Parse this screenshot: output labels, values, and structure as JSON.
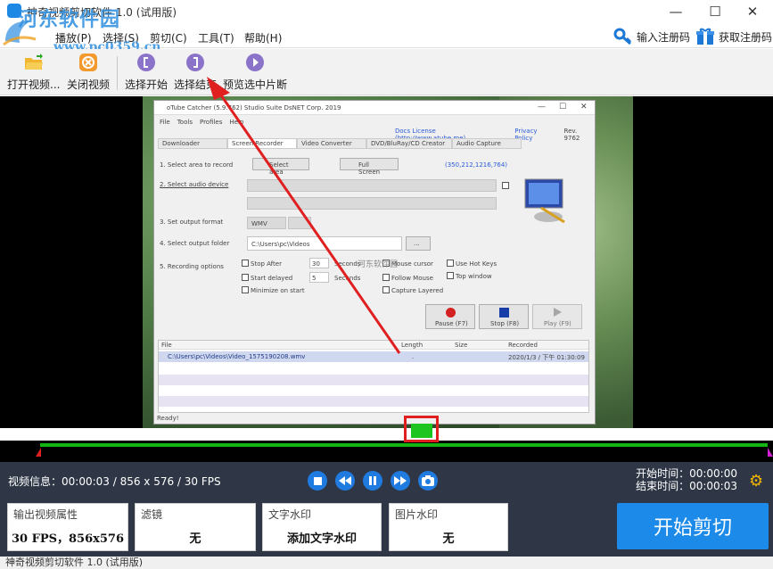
{
  "window": {
    "title": "神奇视频剪切软件 1.0 (试用版)",
    "min_symbol": "—",
    "max_symbol": "☐",
    "close_symbol": "✕"
  },
  "watermark": {
    "site_name": "河东软件园",
    "url": "www.pc0359.cn"
  },
  "menubar": {
    "items": [
      "播放(P)",
      "选择(S)",
      "剪切(C)",
      "工具(T)",
      "帮助(H)"
    ],
    "register_code": "输入注册码",
    "get_code": "获取注册码"
  },
  "toolbar": {
    "open_video": "打开视频...",
    "close_video": "关闭视频",
    "select_start": "选择开始",
    "select_end": "选择结束",
    "preview_selected": "预览选中片断"
  },
  "inner_window": {
    "title": "oTube Catcher (5.9.762)  Studio Suite  DsNET Corp. 2019",
    "menu": [
      "File",
      "Tools",
      "Profiles",
      "Help"
    ],
    "links": [
      "Docs License (http://www.atube.me)",
      "Privacy Policy",
      "Rev. 9762"
    ],
    "tabs": [
      "Downloader",
      "Screen Recorder",
      "Video Converter",
      "DVD/BluRay/CD Creator",
      "Audio Capture"
    ],
    "rows": {
      "r1": "1. Select area to record",
      "r2": "2. Select audio device",
      "r3": "3. Set output format",
      "r4": "4. Select output folder",
      "r5": "5. Recording options"
    },
    "btn_select_area": "Select area",
    "btn_full_screen": "Full Screen",
    "coords": "(350,212,1216,764)",
    "format": "WMV",
    "folder": "C:\\Users\\pc\\Videos",
    "browse": "...",
    "options": {
      "stop_after": "Stop After",
      "stop_after_val": "30",
      "seconds": "Seconds",
      "start_delayed": "Start delayed",
      "start_delayed_val": "5",
      "seconds2": "Seconds",
      "minimize": "Minimize on start",
      "mouse_cursor": "Mouse cursor",
      "follow_mouse": "Follow Mouse",
      "capture_layered": "Capture Layered",
      "hot_keys": "Use Hot Keys",
      "top_window": "Top window"
    },
    "rec_buttons": [
      "Pause (F7)",
      "Stop (F8)",
      "Play (F9)"
    ],
    "list_headers": [
      "File",
      "Length",
      "Size",
      "Recorded"
    ],
    "list_row": {
      "file": "C:\\Users\\pc\\Videos\\Video_1575190208.wmv",
      "length": ".",
      "recorded": "2020/1/3 / 下午 01:30:09"
    },
    "status": "Ready!",
    "watermark": "河东软件园"
  },
  "controls": {
    "video_info_label": "视频信息：",
    "video_info": "00:00:03 / 856 x 576 / 30 FPS",
    "start_time_label": "开始时间：",
    "start_time": "00:00:00",
    "end_time_label": "结束时间：",
    "end_time": "00:00:03"
  },
  "panels": {
    "output_label": "输出视频属性",
    "output_value": "30 FPS，856x576",
    "filter_label": "滤镜",
    "filter_value": "无",
    "text_wm_label": "文字水印",
    "text_wm_value": "添加文字水印",
    "image_wm_label": "图片水印",
    "image_wm_value": "无",
    "start_cut": "开始剪切"
  },
  "statusbar": {
    "text": "神奇视频剪切软件 1.0 (试用版)"
  },
  "colors": {
    "accent_blue": "#1c8ae8",
    "control_bg": "#2f3746",
    "timeline_green": "#13b513",
    "highlight_red": "#e02020"
  }
}
